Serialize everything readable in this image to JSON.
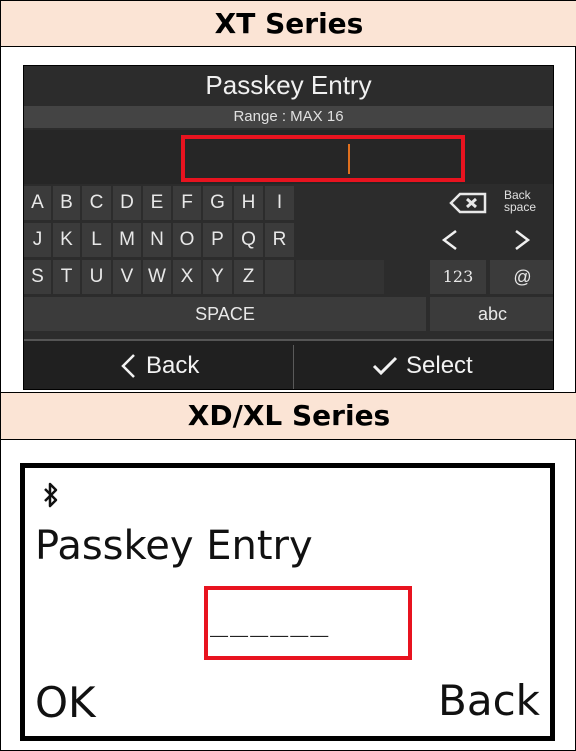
{
  "xt": {
    "header": "XT Series",
    "title": "Passkey Entry",
    "range": "Range : MAX 16",
    "keys_row1": [
      "A",
      "B",
      "C",
      "D",
      "E",
      "F",
      "G",
      "H",
      "I"
    ],
    "keys_row2": [
      "J",
      "K",
      "L",
      "M",
      "N",
      "O",
      "P",
      "Q",
      "R"
    ],
    "keys_row3": [
      "S",
      "T",
      "U",
      "V",
      "W",
      "X",
      "Y",
      "Z"
    ],
    "backspace_label": "Back space",
    "num_key": "123",
    "at_key": "@",
    "space_key": "SPACE",
    "abc_key": "abc",
    "back_label": "Back",
    "select_label": "Select"
  },
  "xd": {
    "header": "XD/XL Series",
    "title": "Passkey Entry",
    "entry_placeholder": "______",
    "ok_label": "OK",
    "back_label": "Back"
  },
  "colors": {
    "header_bg": "#fbe4d5",
    "highlight": "#e8131f",
    "screen_bg": "#2c2c2c",
    "key_bg": "#3b3b3b",
    "cursor": "#e0701e"
  }
}
